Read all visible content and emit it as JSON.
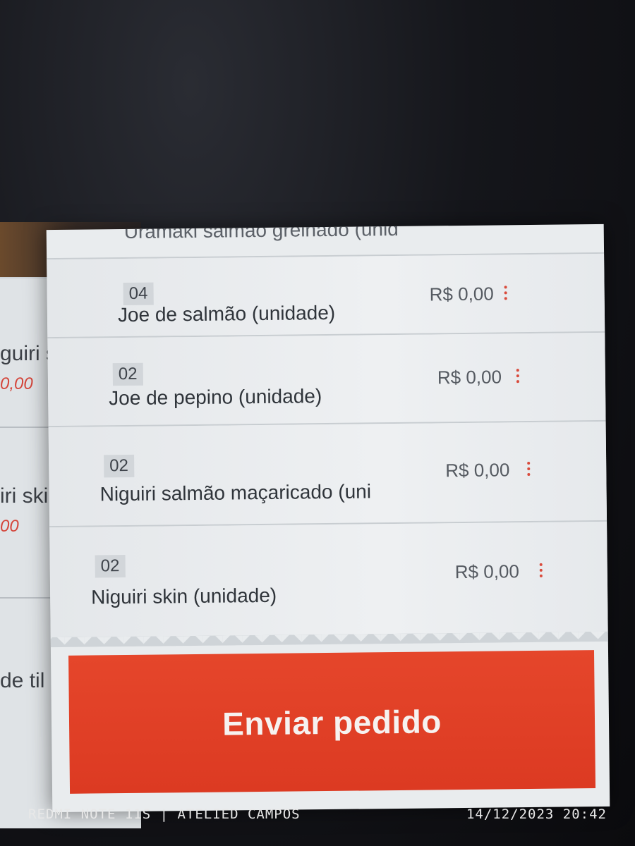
{
  "background_app": {
    "items": [
      {
        "name": "guiri salm",
        "price": "0,00"
      },
      {
        "name": "iri skin",
        "price": "00"
      },
      {
        "name": "de til",
        "price": ""
      }
    ]
  },
  "order_popup": {
    "cut_item": "Uramaki salmão grelhado (unid",
    "items": [
      {
        "qty": "04",
        "name": "Joe de salmão (unidade)",
        "price": "R$ 0,00"
      },
      {
        "qty": "02",
        "name": "Joe de pepino (unidade)",
        "price": "R$ 0,00"
      },
      {
        "qty": "02",
        "name": "Niguiri salmão maçaricado (uni",
        "price": "R$ 0,00"
      },
      {
        "qty": "02",
        "name": "Niguiri skin (unidade)",
        "price": "R$ 0,00"
      }
    ],
    "send_button_label": "Enviar pedido"
  },
  "watermark": {
    "device": "REDMI NOTE 11S | ATELIED CAMPOS",
    "datetime": "14/12/2023   20:42"
  },
  "colors": {
    "accent": "#e1401f",
    "price_red": "#d4453a"
  }
}
